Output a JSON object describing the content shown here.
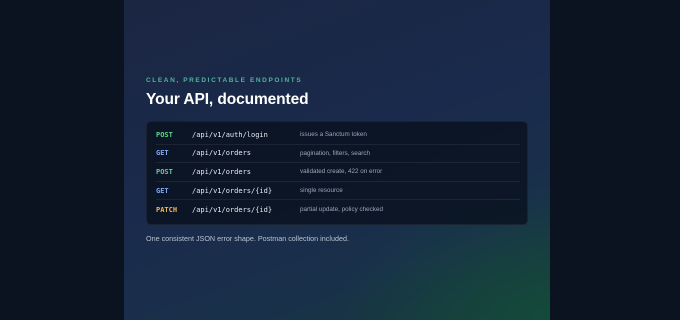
{
  "section": {
    "eyebrow": "CLEAN, PREDICTABLE ENDPOINTS",
    "title": "Your API, documented",
    "footer_note": "One consistent JSON error shape. Postman collection included."
  },
  "method_colors": {
    "POST": "#5fd38a",
    "GET": "#7fa8f0",
    "PATCH": "#f0b55a"
  },
  "endpoints": [
    {
      "method": "POST",
      "path": "/api/v1/auth/login",
      "description": "issues a Sanctum token"
    },
    {
      "method": "GET",
      "path": "/api/v1/orders",
      "description": "pagination, filters, search"
    },
    {
      "method": "POST",
      "path": "/api/v1/orders",
      "description": "validated create, 422 on error"
    },
    {
      "method": "GET",
      "path": "/api/v1/orders/{id}",
      "description": "single resource"
    },
    {
      "method": "PATCH",
      "path": "/api/v1/orders/{id}",
      "description": "partial update, policy checked"
    }
  ]
}
